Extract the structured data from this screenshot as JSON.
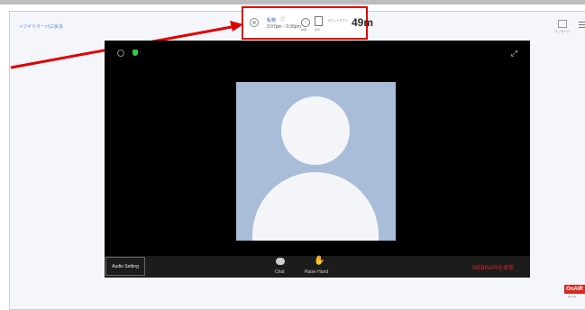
{
  "page": {
    "back_label": "< ▽イトリーバに戻る"
  },
  "session": {
    "title": "私物",
    "time": "2:07pm - 3:30pm",
    "info_label": "詳細",
    "doc_label": "資料",
    "countdown_label": "カウントダウン",
    "countdown_value": "49m"
  },
  "header_right": {
    "label": "メッセージ"
  },
  "video": {
    "audio_setting_label": "Audio Setting",
    "chat_label": "Chat",
    "raise_hand_label": "Raise Hand",
    "leave_label": "WEBINARを退室"
  },
  "branding": {
    "onair_label": "OnAIR",
    "onair_sub": "Events"
  },
  "colors": {
    "highlight_red": "#e10000",
    "leave_red": "#e0261f",
    "avatar_bg": "#a9bdd8"
  }
}
